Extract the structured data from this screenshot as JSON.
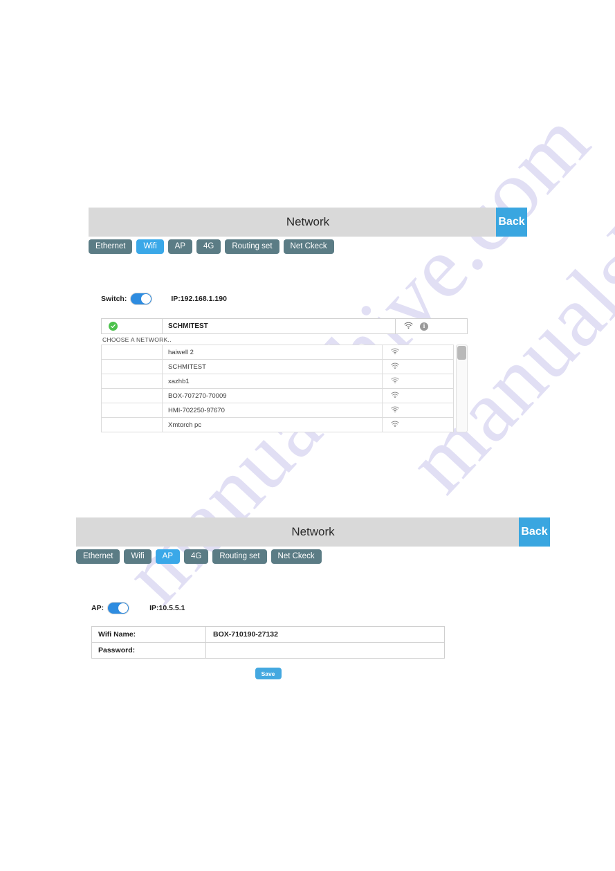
{
  "watermark": {
    "line1": "manualshive.com",
    "line2": "manualshive.com"
  },
  "panel_wifi": {
    "header": {
      "title": "Network",
      "back_label": "Back"
    },
    "tabs": [
      {
        "label": "Ethernet",
        "active": false
      },
      {
        "label": "Wifi",
        "active": true
      },
      {
        "label": "AP",
        "active": false
      },
      {
        "label": "4G",
        "active": false
      },
      {
        "label": "Routing set",
        "active": false
      },
      {
        "label": "Net Ckeck",
        "active": false
      }
    ],
    "switch": {
      "label": "Switch:",
      "state": "on",
      "ip": "IP:192.168.1.190"
    },
    "connected": {
      "ssid": "SCHMITEST",
      "status": "connected",
      "signal_icon": "wifi-icon",
      "info_icon": "info-icon"
    },
    "choose_label": "CHOOSE A NETWORK..",
    "networks": [
      {
        "ssid": "haiwell 2",
        "signal_icon": "wifi-icon"
      },
      {
        "ssid": "SCHMITEST",
        "signal_icon": "wifi-icon"
      },
      {
        "ssid": "xazhb1",
        "signal_icon": "wifi-icon"
      },
      {
        "ssid": "BOX-707270-70009",
        "signal_icon": "wifi-icon"
      },
      {
        "ssid": "HMI-702250-97670",
        "signal_icon": "wifi-icon"
      },
      {
        "ssid": "Xmtorch pc",
        "signal_icon": "wifi-icon"
      }
    ]
  },
  "panel_ap": {
    "header": {
      "title": "Network",
      "back_label": "Back"
    },
    "tabs": [
      {
        "label": "Ethernet",
        "active": false
      },
      {
        "label": "Wifi",
        "active": false
      },
      {
        "label": "AP",
        "active": true
      },
      {
        "label": "4G",
        "active": false
      },
      {
        "label": "Routing set",
        "active": false
      },
      {
        "label": "Net Ckeck",
        "active": false
      }
    ],
    "switch": {
      "label": "AP:",
      "state": "on",
      "ip": "IP:10.5.5.1"
    },
    "form": {
      "rows": [
        {
          "key": "Wifi Name:",
          "value": "BOX-710190-27132"
        },
        {
          "key": "Password:",
          "value": ""
        }
      ],
      "save_label": "Save"
    }
  },
  "colors": {
    "accent_blue": "#3aa8e8",
    "tab_gray": "#5b7c85",
    "titlebar_gray": "#d9d9d9",
    "status_green": "#4cc24c",
    "watermark_purple": "#c9c6ec"
  }
}
